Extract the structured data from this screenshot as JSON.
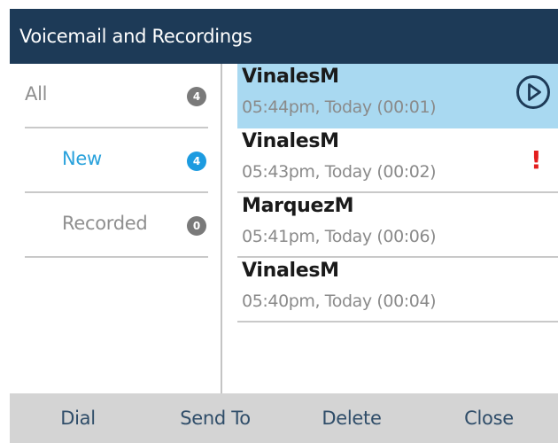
{
  "title": "Voicemail and Recordings",
  "sidebar": {
    "items": [
      {
        "label": "All",
        "count": "4",
        "active": false
      },
      {
        "label": "New",
        "count": "4",
        "active": true
      },
      {
        "label": "Recorded",
        "count": "0",
        "active": false
      }
    ]
  },
  "messages": [
    {
      "name": "VinalesM",
      "detail": "05:44pm, Today (00:01)",
      "selected": true,
      "indicator": "play-icon"
    },
    {
      "name": "VinalesM",
      "detail": "05:43pm, Today (00:02)",
      "selected": false,
      "indicator": "urgent-icon",
      "urgent_mark": "!"
    },
    {
      "name": "MarquezM",
      "detail": "05:41pm, Today (00:06)",
      "selected": false
    },
    {
      "name": "VinalesM",
      "detail": "05:40pm, Today (00:04)",
      "selected": false
    }
  ],
  "softkeys": [
    "Dial",
    "Send To",
    "Delete",
    "Close"
  ],
  "colors": {
    "titlebar": "#1d3a57",
    "active_text": "#2aa2dc",
    "active_badge": "#1c9be0",
    "selected_row": "#a9d9f1",
    "urgent": "#e31d1d",
    "softkey_bar": "#d4d4d4"
  }
}
